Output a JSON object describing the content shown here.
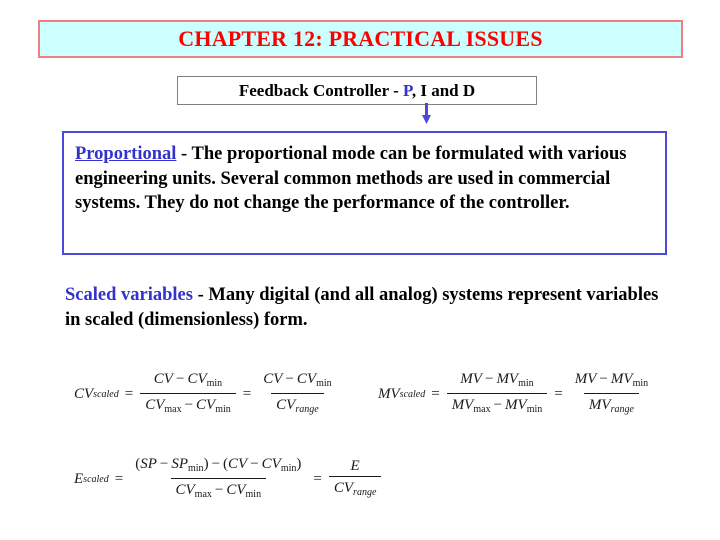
{
  "slide": {
    "title": {
      "text": "CHAPTER 12: PRACTICAL ISSUES",
      "text_color": "#ff0000",
      "fill_color": "#ccffff",
      "border_color": "#f08080"
    },
    "feedback_box": {
      "prefix": "Feedback Controller - ",
      "accent": "P",
      "suffix": ", I and D",
      "accent_color": "#3333cc",
      "border_color": "#808080"
    },
    "arrow": {
      "name": "down-arrow",
      "color": "#4a4ad8"
    },
    "proportional_box": {
      "border_color": "#4a4ad8",
      "lead": "Proportional",
      "lead_color": "#3333cc",
      "body": " - The proportional mode can be formulated with various engineering units.  Several common methods are used in commercial systems.  They do not change the performance of the controller."
    },
    "scaled_paragraph": {
      "lead": "Scaled variables",
      "lead_color": "#3333cc",
      "body": " - Many digital (and all analog) systems represent variables in scaled (dimensionless) form."
    },
    "equations": [
      {
        "id": "eq-cv",
        "lhs_var": "CV",
        "lhs_sub": "scaled",
        "frac1_num": [
          "CV",
          "−",
          "CV",
          "min"
        ],
        "frac1_den": [
          "CV",
          "max",
          "−",
          "CV",
          "min"
        ],
        "frac2_num": [
          "CV",
          "−",
          "CV",
          "min"
        ],
        "frac2_den": [
          "CV",
          "range"
        ],
        "plain": "CV_scaled = (CV - CV_min) / (CV_max - CV_min) = (CV - CV_min) / CV_range"
      },
      {
        "id": "eq-mv",
        "lhs_var": "MV",
        "lhs_sub": "scaled",
        "frac1_num": [
          "MV",
          "−",
          "MV",
          "min"
        ],
        "frac1_den": [
          "MV",
          "max",
          "−",
          "MV",
          "min"
        ],
        "frac2_num": [
          "MV",
          "−",
          "MV",
          "min"
        ],
        "frac2_den": [
          "MV",
          "range"
        ],
        "plain": "MV_scaled = (MV - MV_min) / (MV_max - MV_min) = (MV - MV_min) / MV_range"
      },
      {
        "id": "eq-e",
        "lhs_var": "E",
        "lhs_sub": "scaled",
        "frac1_num": [
          "(SP",
          "−",
          "SP",
          "min",
          ")",
          "−",
          "(CV",
          "−",
          "CV",
          "min",
          ")"
        ],
        "frac1_den": [
          "CV",
          "max",
          "−",
          "CV",
          "min"
        ],
        "frac2_num": [
          "E"
        ],
        "frac2_den": [
          "CV",
          "range"
        ],
        "plain": "E_scaled = ((SP - SP_min) - (CV - CV_min)) / (CV_max - CV_min) = E / CV_range"
      }
    ],
    "symbols": {
      "minus": "−",
      "equals": "=",
      "lparen": "(",
      "rparen": ")",
      "sub_min": "min",
      "sub_max": "max",
      "sub_range": "range",
      "sub_scaled": "scaled",
      "cv": "CV",
      "mv": "MV",
      "sp": "SP",
      "e": "E"
    }
  }
}
